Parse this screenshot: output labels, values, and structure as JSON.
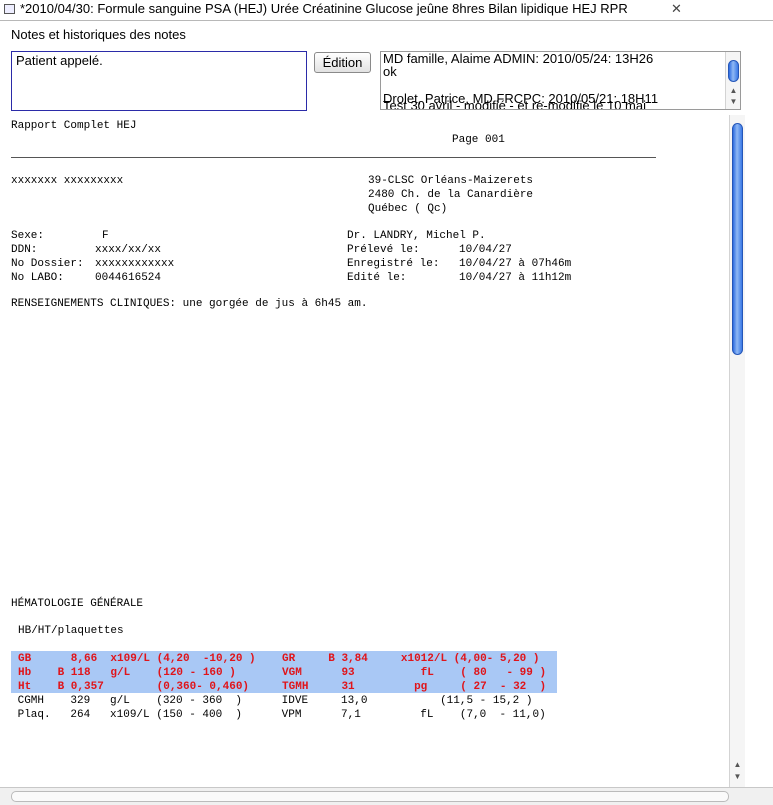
{
  "tab": {
    "title": "*2010/04/30: Formule sanguine PSA (HEJ) Urée Créatinine Glucose jeûne 8hres Bilan lipidique HEJ RPR",
    "close": "✕"
  },
  "notes": {
    "section_label": "Notes et historiques des notes",
    "input_value": "Patient appelé.",
    "edit_button": "Édition",
    "history": {
      "line1": "MD famille, Alaime ADMIN: 2010/05/24: 13H26",
      "line2": "ok",
      "line3": "Drolet, Patrice, MD FRCPC: 2010/05/21: 18H11",
      "line4": "Test 30 avril - modifié - et re-modifié le 10 mai"
    }
  },
  "report": {
    "header_left": "Rapport Complet HEJ",
    "page": "Page 001",
    "patient_name": "xxxxxxx xxxxxxxxx",
    "clinic": "39-CLSC Orléans-Maizerets",
    "address1": "2480 Ch. de la Canardière",
    "address2": "Québec ( Qc)",
    "sexe_label": "Sexe:",
    "sexe_value": "F",
    "ddn_label": "DDN:",
    "ddn_value": "xxxx/xx/xx",
    "dossier_label": "No Dossier:",
    "dossier_value": "xxxxxxxxxxxx",
    "labo_label": "No LABO:",
    "labo_value": "0044616524",
    "doctor": "Dr. LANDRY, Michel P.",
    "preleve_label": "Prélevé le:",
    "preleve_value": "10/04/27",
    "enregistre_label": "Enregistré le:",
    "enregistre_value": "10/04/27 à 07h46m",
    "edite_label": "Edité le:",
    "edite_value": "10/04/27 à 11h12m",
    "clinical": "RENSEIGNEMENTS CLINIQUES: une gorgée de jus à 6h45 am.",
    "section": "HÉMATOLOGIE GÉNÉRALE",
    "subsection": "HB/HT/plaquettes",
    "results": {
      "r1": "GB      8,66  x109/L (4,20  -10,20 )    GR     B 3,84     x1012/L (4,00- 5,20 )",
      "r2": "Hb    B 118   g/L    (120 - 160 )       VGM      93          fL    ( 80   - 99 )",
      "r3": "Ht    B 0,357        (0,360- 0,460)     TGMH     31         pg     ( 27  - 32  )",
      "r4": " CGMH    329   g/L    (320 - 360  )      IDVE     13,0           (11,5 - 15,2 )",
      "r5": " Plaq.   264   x109/L (150 - 400  )      VPM      7,1         fL    (7,0  - 11,0)"
    }
  }
}
